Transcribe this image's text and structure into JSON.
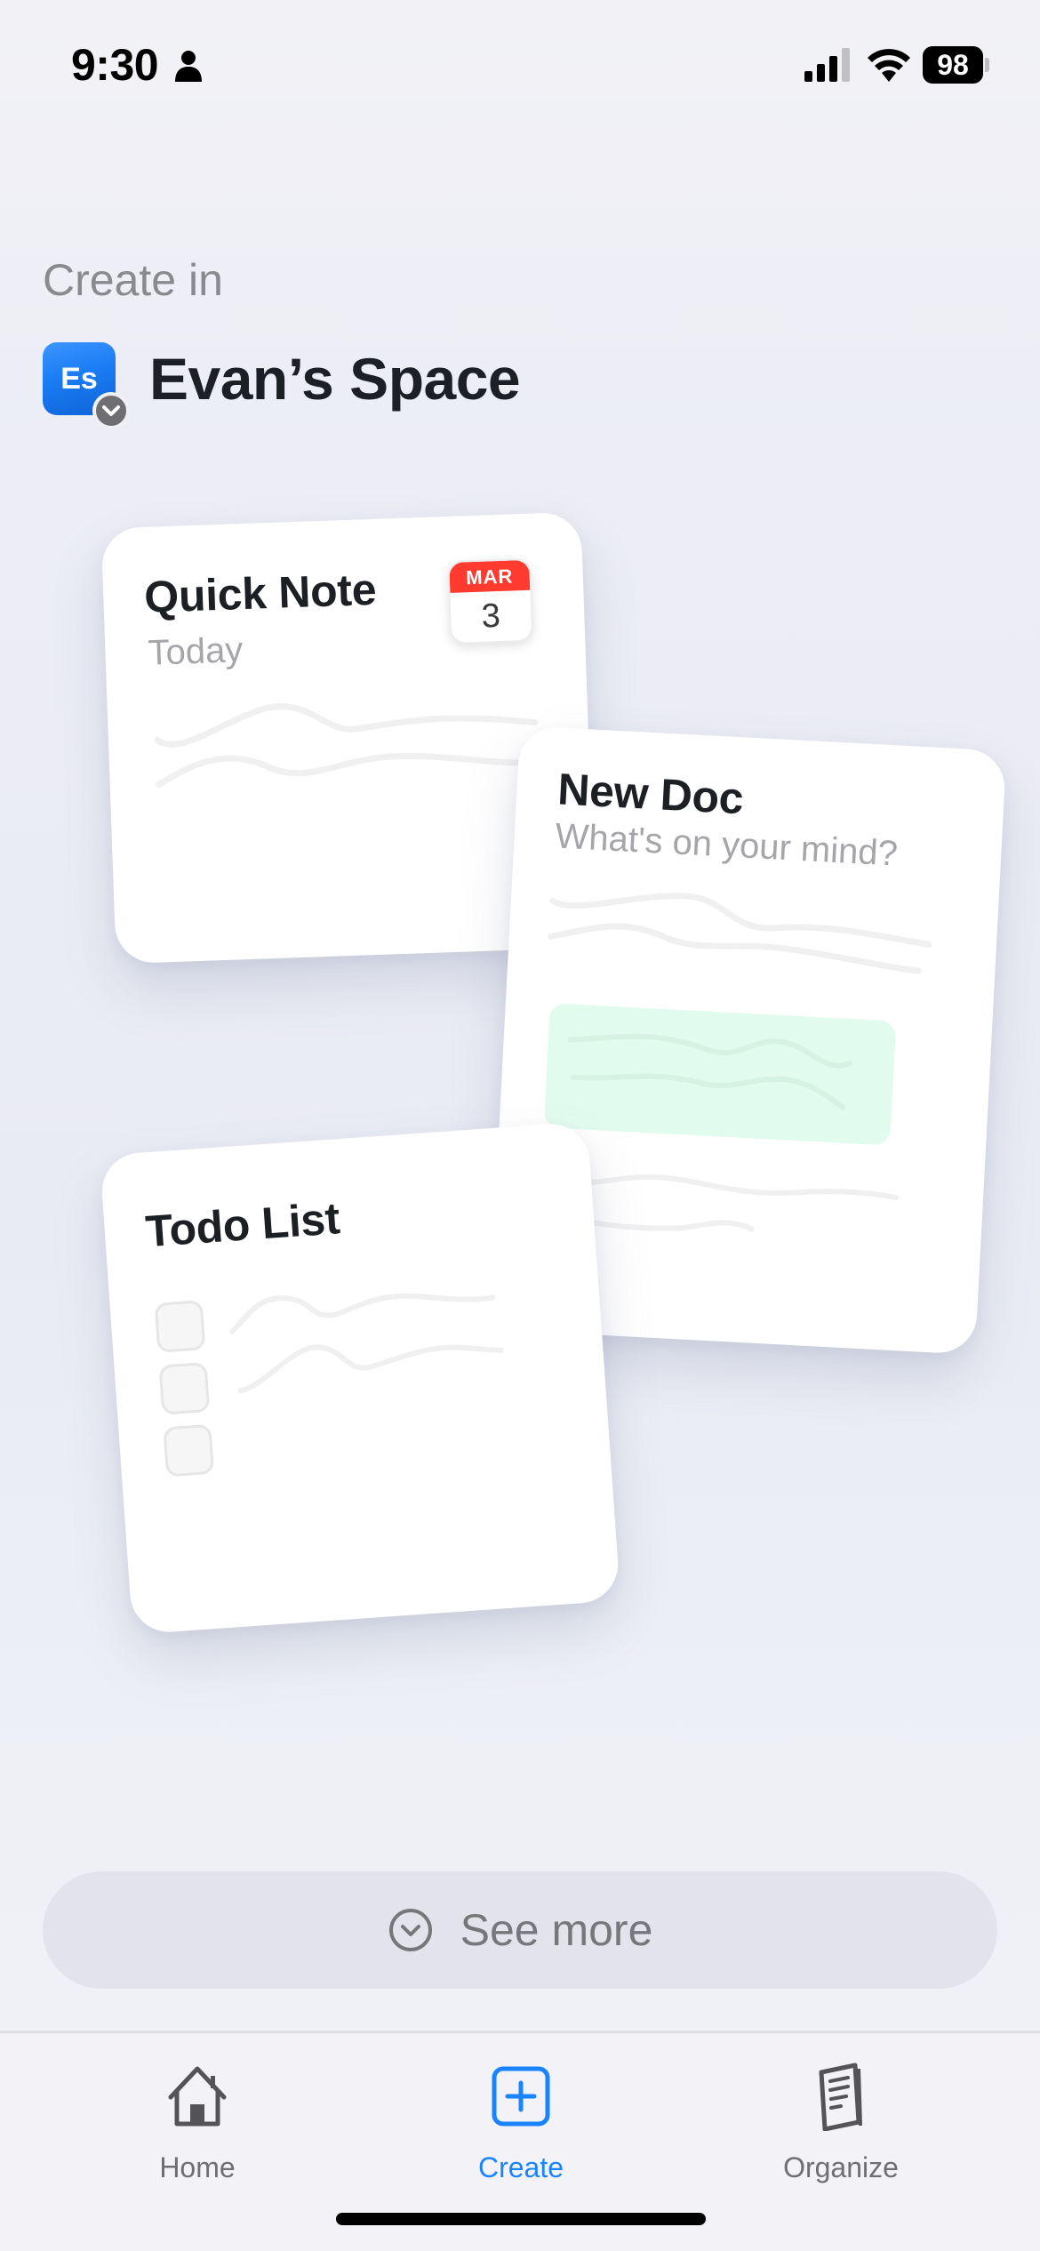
{
  "status_bar": {
    "time": "9:30",
    "battery_level": "98",
    "icons": [
      "person-icon",
      "cellular-signal-icon",
      "wifi-icon",
      "battery-icon"
    ]
  },
  "header": {
    "label": "Create in",
    "space_initials": "Es",
    "space_name": "Evan’s Space",
    "space_badge_icon": "chevron-down-icon"
  },
  "templates": [
    {
      "title": "Quick Note",
      "subtitle": "Today",
      "calendar": {
        "month": "MAR",
        "day": "3"
      }
    },
    {
      "title": "New Doc",
      "subtitle": "What's on your mind?",
      "highlight_color": "#e2fbef"
    },
    {
      "title": "Todo List",
      "checkbox_count": 3
    }
  ],
  "see_more": {
    "label": "See more",
    "icon": "chevron-down-circle-icon"
  },
  "tab_bar": {
    "active": "Create",
    "accent_color": "#1a84ff",
    "tabs": [
      {
        "label": "Home",
        "icon": "house-icon"
      },
      {
        "label": "Create",
        "icon": "plus-square-icon"
      },
      {
        "label": "Organize",
        "icon": "document-stack-icon"
      }
    ]
  }
}
